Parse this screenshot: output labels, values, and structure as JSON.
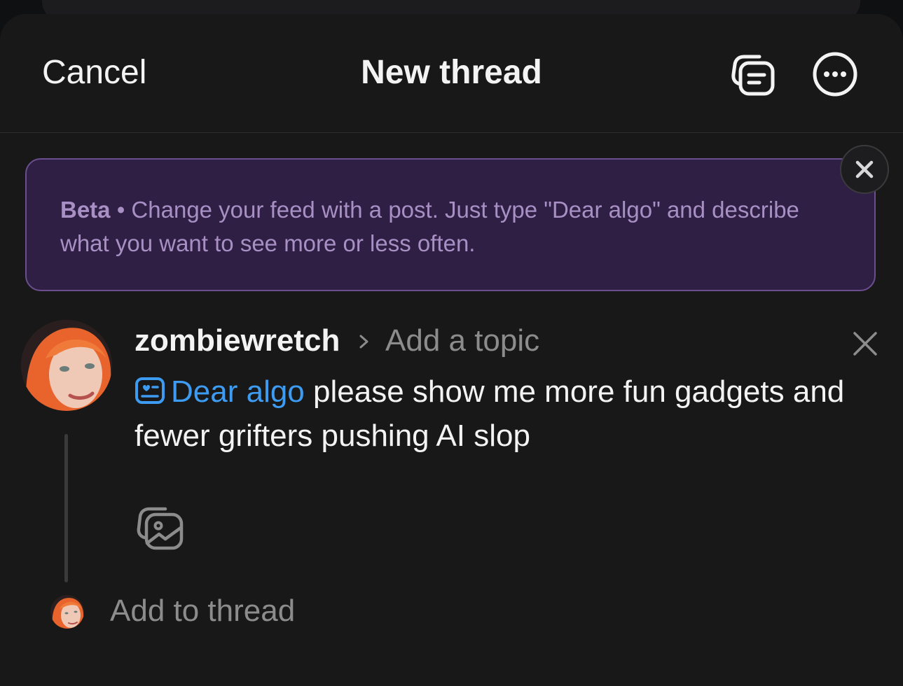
{
  "header": {
    "cancel_label": "Cancel",
    "title": "New thread",
    "drafts_icon": "drafts-icon",
    "more_icon": "more-options-icon"
  },
  "banner": {
    "badge": "Beta",
    "separator": " • ",
    "message": "Change your feed with a post. Just type \"Dear algo\" and describe what you want to see more or less often.",
    "close_icon": "close-icon",
    "colors": {
      "background": "#2f1f44",
      "border": "#6a4e8e",
      "text": "#a890c4"
    }
  },
  "composer": {
    "username": "zombiewretch",
    "topic_placeholder": "Add a topic",
    "algo_tag": "Dear algo",
    "body_text": " please show me more fun gadgets and fewer grifters pushing AI slop",
    "media_icon": "image-gallery-icon",
    "accent_color": "#3d9bf2"
  },
  "footer": {
    "add_to_thread_placeholder": "Add to thread"
  }
}
